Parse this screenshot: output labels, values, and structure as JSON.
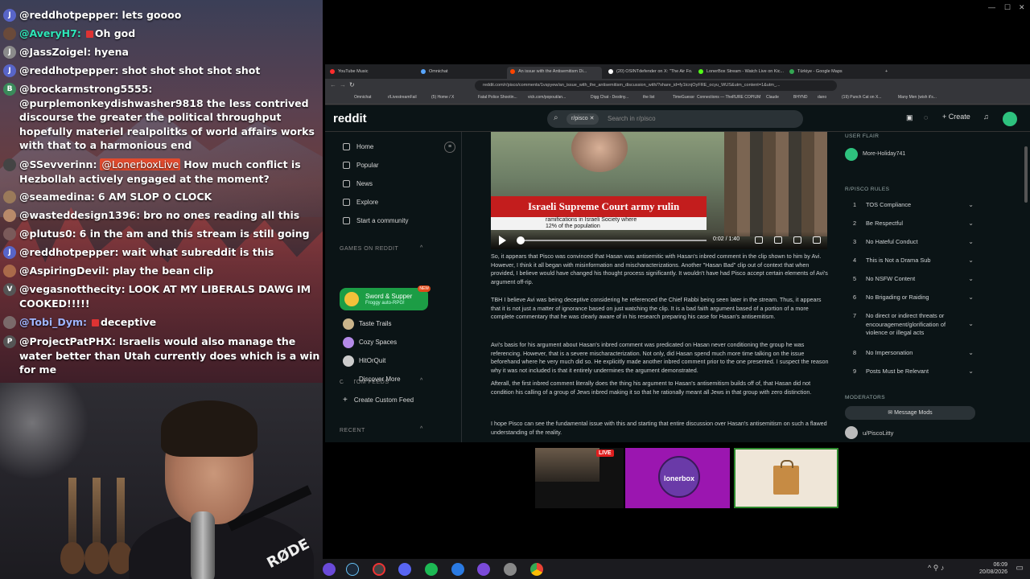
{
  "chat": {
    "messages": [
      {
        "initial": "J",
        "avatar_color": "#5865c8",
        "user": "@reddhotpepper:",
        "user_color": "#ffffff",
        "body": "lets goooo"
      },
      {
        "initial": "",
        "avatar_color": "#6a4a3a",
        "user": "@AveryH7:",
        "user_color": "#2ee6b8",
        "body": "Oh god",
        "badge": true
      },
      {
        "initial": "J",
        "avatar_color": "#8b8b8b",
        "user": "@JassZoigel:",
        "user_color": "#ffffff",
        "body": "hyena"
      },
      {
        "initial": "J",
        "avatar_color": "#5865c8",
        "user": "@reddhotpepper:",
        "user_color": "#ffffff",
        "body": "shot shot shot shot shot"
      },
      {
        "initial": "B",
        "avatar_color": "#3a8a5a",
        "user": "@brockarmstrong5555:",
        "user_color": "#ffffff",
        "body": "@purplemonkeydishwasher9818 the less contrived discourse the greater the political throughput hopefully materiel realpolitks of world affairs works with that to a harmonious end"
      },
      {
        "initial": "",
        "avatar_color": "#444",
        "user": "@SSevverinn:",
        "user_color": "#ffffff",
        "mention": "@LonerboxLive",
        "body": "How much conflict is Hezbollah actively engaged at the moment?"
      },
      {
        "initial": "",
        "avatar_color": "#9a7a5a",
        "user": "@seamedina:",
        "user_color": "#ffffff",
        "body": "6 AM SLOP O CLOCK"
      },
      {
        "initial": "",
        "avatar_color": "#b88a6a",
        "user": "@wasteddesign1396:",
        "user_color": "#ffffff",
        "body": "bro no ones reading all this"
      },
      {
        "initial": "",
        "avatar_color": "#7a5a5a",
        "user": "@plutus0:",
        "user_color": "#ffffff",
        "body": "6 in the am and this stream is still going"
      },
      {
        "initial": "J",
        "avatar_color": "#5865c8",
        "user": "@reddhotpepper:",
        "user_color": "#ffffff",
        "body": "wait what subreddit is this"
      },
      {
        "initial": "",
        "avatar_color": "#aa6a4a",
        "user": "@AspiringDevil:",
        "user_color": "#ffffff",
        "body": "play the bean clip"
      },
      {
        "initial": "V",
        "avatar_color": "#555",
        "user": "@vegasnotthecity:",
        "user_color": "#ffffff",
        "body": "LOOK AT MY LIBERALS DAWG IM COOKED!!!!!"
      },
      {
        "initial": "",
        "avatar_color": "#7a6a6a",
        "user": "@Tobi_Dym:",
        "user_color": "#9fb6ff",
        "body": "deceptive",
        "badge": true
      },
      {
        "initial": "P",
        "avatar_color": "#555",
        "user": "@ProjectPatPHX:",
        "user_color": "#ffffff",
        "body": "Israelis would also manage the water better than Utah currently does which is a win for me"
      }
    ]
  },
  "camera": {
    "mic_brand": "RØDE"
  },
  "browser": {
    "tabs": [
      {
        "label": "YouTube Music",
        "color": "#ff2d2d"
      },
      {
        "label": "Omnichat",
        "color": "#58a6ff"
      },
      {
        "label": "An issue with the Antisemitism Di...",
        "color": "#ff4500"
      },
      {
        "label": "(20) OSINTdefender on X: \"The Air Fo...",
        "color": "#ffffff"
      },
      {
        "label": "LonerBox Stream - Watch Live on Kic...",
        "color": "#53fc18"
      },
      {
        "label": "Türkiye - Google Maps",
        "color": "#34a853"
      }
    ],
    "url": "reddit.com/r/pisco/comments/1vspyew/an_issue_with_the_antisemitism_discussion_with/?share_id=fy1tcnjOyFRE_ocyu_WUS&utm_content=1&utm_...",
    "bookmarks": [
      "Omnichat",
      "r/LivestreamFail",
      "(5) Home / X",
      "Fatal Police Shootin...",
      "vick.com/popout/an...",
      "Digg Chat - Destiny...",
      "the list",
      "TimeGuessr",
      "Connections — The...",
      "PURE COPIUM",
      "Claude",
      "BHYND",
      "dano",
      "(19) Punch Cat on X...",
      "Many Men (wish it's..."
    ]
  },
  "reddit": {
    "logo": "reddit",
    "search_chip": "r/pisco",
    "search_placeholder": "Search in r/pisco",
    "create_label": "Create",
    "nav": [
      "Home",
      "Popular",
      "News",
      "Explore",
      "Start a community"
    ],
    "games_header": "GAMES ON REDDIT",
    "featured_game": {
      "title": "Sword & Supper",
      "subtitle": "Froggy auto-RPG!",
      "badge": "NEW"
    },
    "games": [
      {
        "label": "Taste Trails",
        "color": "#c9b48a"
      },
      {
        "label": "Cozy Spaces",
        "color": "#b48ae8"
      },
      {
        "label": "HitOrQuit",
        "color": "#cccccc"
      },
      {
        "label": "Discover More",
        "color": "#0b1416"
      }
    ],
    "custom_feeds_header": "CUSTOM FEEDS",
    "create_custom_feed": "Create Custom Feed",
    "recent_header": "RECENT",
    "video": {
      "banner": "Israeli Supreme Court army rulin",
      "subtitle_1": "ramifications in Israeli Society where",
      "subtitle_2": "12% of the population",
      "time": "0:02 / 1:40"
    },
    "paragraphs": [
      "So, it appears that Pisco was convinced that Hasan was antisemitic with Hasan's inbred comment in the clip shown to him by Avi. However, I think it all began with misinformation and mischaracterizations. Another \"Hasan Bad\" clip out of context that when provided, I believe would have changed his thought process significantly. It wouldn't have had Pisco accept certain elements of Avi's argument off-rip.",
      "TBH I believe Avi was being deceptive considering he referenced the Chief Rabbi being seen later in the stream. Thus, it appears that it is not just a matter of ignorance based on just watching the clip. It is a bad faith argument based of a portion of a more complete commentary that he was clearly aware of in his research preparing his case for Hasan's antisemitism.",
      "Avi's basis for his argument about Hasan's inbred comment was predicated on Hasan never conditioning the group he was referencing. However, that is a severe mischaracterization. Not only, did Hasan spend much more time talking on the issue beforehand where he very much did so. He explicitly made another inbred comment prior to the one presented. I suspect the reason why it was not included is that it entirely undermines the argument demonstrated.",
      "Afterall, the first inbred comment literally does the thing his argument to Hasan's antisemitism builds off of, that Hasan did not condition his calling of a group of Jews inbred making it so that he rationally meant all Jews in that group with zero distinction.",
      "I hope Pisco can see the fundamental issue with this and starting that entire discussion over Hasan's antisemitism on such a flawed understanding of the reality."
    ],
    "user_flair_header": "USER FLAIR",
    "user_flair": "More-Holiday741",
    "rules_header": "R/PISCO RULES",
    "rules": [
      "TOS Compliance",
      "Be Respectful",
      "No Hateful Conduct",
      "This is Not a Drama Sub",
      "No NSFW Content",
      "No Brigading or Raiding",
      "No direct or indirect threats or encouragement/glorification of violence or illegal acts",
      "No Impersonation",
      "Posts Must be Relevant"
    ],
    "moderators_header": "MODERATORS",
    "message_mods": "Message Mods",
    "moderator": "u/PiscoLitty"
  },
  "thumbnails": {
    "live_badge": "LIVE",
    "lonerbox_label": "lonerbox"
  },
  "taskbar": {
    "time": "06:09",
    "date": "20/08/2026"
  }
}
